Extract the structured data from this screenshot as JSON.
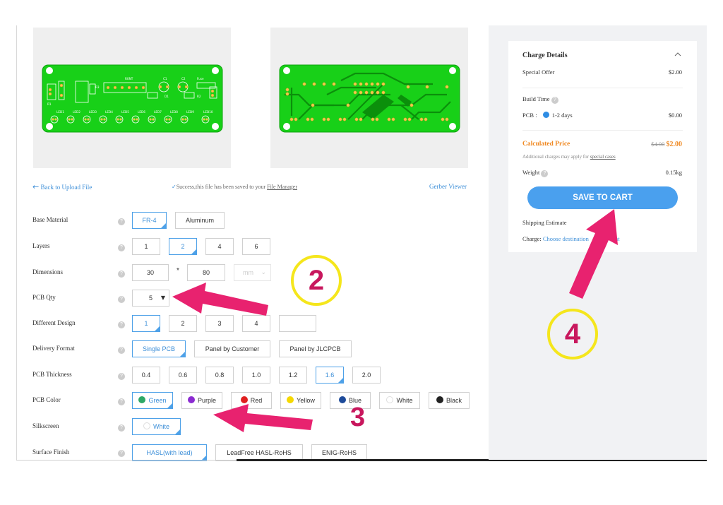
{
  "links": {
    "back": "Back to Upload File",
    "success_prefix": "Success,this file has been saved to your",
    "file_manager": "File Manager",
    "gerber_viewer": "Gerber Viewer"
  },
  "preview_front": {
    "top_labels": [
      "R0NT",
      "C1",
      "C2",
      "Fuse"
    ],
    "side_labels": [
      "R1",
      "R3"
    ],
    "led_labels": [
      "LED1",
      "LED2",
      "LED3",
      "LED4",
      "LED5",
      "LED6",
      "LED7",
      "LED8",
      "LED9",
      "LED10"
    ],
    "mid_labels": [
      "D1",
      "R2"
    ]
  },
  "form": {
    "base_material": {
      "label": "Base Material",
      "options": [
        "FR-4",
        "Aluminum"
      ],
      "selected": 0
    },
    "layers": {
      "label": "Layers",
      "options": [
        "1",
        "2",
        "4",
        "6"
      ],
      "selected": 1
    },
    "dimensions": {
      "label": "Dimensions",
      "width": "30",
      "sep": "*",
      "height": "80",
      "unit": "mm"
    },
    "pcb_qty": {
      "label": "PCB Qty",
      "value": "5"
    },
    "different_design": {
      "label": "Different Design",
      "options": [
        "1",
        "2",
        "3",
        "4",
        ""
      ],
      "selected": 0
    },
    "delivery_format": {
      "label": "Delivery Format",
      "options": [
        "Single PCB",
        "Panel by Customer",
        "Panel by JLCPCB"
      ],
      "selected": 0
    },
    "pcb_thickness": {
      "label": "PCB Thickness",
      "options": [
        "0.4",
        "0.6",
        "0.8",
        "1.0",
        "1.2",
        "1.6",
        "2.0"
      ],
      "selected": 5
    },
    "pcb_color": {
      "label": "PCB Color",
      "options": [
        {
          "name": "Green",
          "color": "#2ea866"
        },
        {
          "name": "Purple",
          "color": "#8b2bd1"
        },
        {
          "name": "Red",
          "color": "#e02020"
        },
        {
          "name": "Yellow",
          "color": "#f5d800"
        },
        {
          "name": "Blue",
          "color": "#1e4b9a"
        },
        {
          "name": "White",
          "color": "#ffffff"
        },
        {
          "name": "Black",
          "color": "#222222"
        }
      ],
      "selected": 0
    },
    "silkscreen": {
      "label": "Silkscreen",
      "value": "White"
    },
    "surface_finish": {
      "label": "Surface Finish",
      "options": [
        "HASL(with lead)",
        "LeadFree HASL-RoHS",
        "ENIG-RoHS"
      ],
      "selected": 0
    }
  },
  "charge": {
    "title": "Charge Details",
    "special_offer_label": "Special Offer",
    "special_offer_value": "$2.00",
    "build_time_label": "Build Time",
    "pcb_label": "PCB :",
    "pcb_time": "1-2 days",
    "pcb_value": "$0.00",
    "calc_label": "Calculated Price",
    "old_price": "$4.00",
    "new_price": "$2.00",
    "additional_prefix": "Additional charges may apply for",
    "special_cases": "special cases",
    "weight_label": "Weight",
    "weight_value": "0.15kg",
    "save_button": "SAVE TO CART",
    "shipping_label": "Shipping Estimate",
    "charge_label": "Charge:",
    "charge_link": "Choose destination",
    "charge_first": "first"
  },
  "annotations": [
    "2",
    "3",
    "4"
  ],
  "colors": {
    "accent": "#4aa0ee",
    "pcb_green": "#18d018",
    "annotation_pink": "#e8226f",
    "annotation_yellow": "#f5e61c"
  }
}
